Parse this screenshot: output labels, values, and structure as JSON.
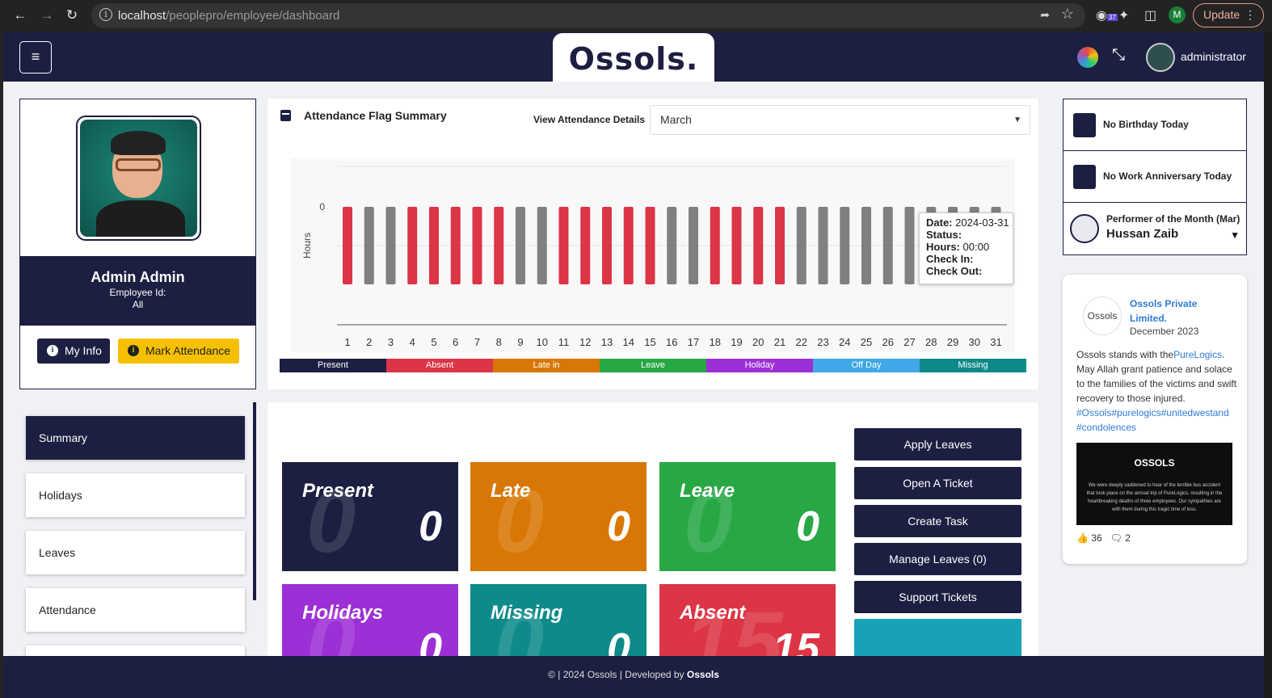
{
  "browser": {
    "url_host": "localhost",
    "url_path": "/peoplepro/employee/dashboard",
    "update_label": "Update",
    "profile_initial": "M",
    "ext_badge": "37"
  },
  "header": {
    "brand": "Ossols.",
    "user": "administrator"
  },
  "profile": {
    "name": "Admin Admin",
    "employee_id_label": "Employee Id:",
    "department": "All",
    "myinfo_label": "My Info",
    "mark_label": "Mark Attendance"
  },
  "sidebar": {
    "items": [
      {
        "label": "Summary"
      },
      {
        "label": "Holidays"
      },
      {
        "label": "Leaves"
      },
      {
        "label": "Attendance"
      }
    ]
  },
  "attendance": {
    "title": "Attendance Flag Summary",
    "view_label": "View Attendance Details",
    "month": "March",
    "y_label": "Hours",
    "y_tick": "0"
  },
  "chart_data": {
    "type": "bar",
    "title": "Attendance Flag Summary",
    "ylabel": "Hours",
    "categories": [
      "1",
      "2",
      "3",
      "4",
      "5",
      "6",
      "7",
      "8",
      "9",
      "10",
      "11",
      "12",
      "13",
      "14",
      "15",
      "16",
      "17",
      "18",
      "19",
      "20",
      "21",
      "22",
      "23",
      "24",
      "25",
      "26",
      "27",
      "28",
      "29",
      "30",
      "31"
    ],
    "colors": [
      "#dc3545",
      "#808080",
      "#808080",
      "#dc3545",
      "#dc3545",
      "#dc3545",
      "#dc3545",
      "#dc3545",
      "#808080",
      "#808080",
      "#dc3545",
      "#dc3545",
      "#dc3545",
      "#dc3545",
      "#dc3545",
      "#808080",
      "#808080",
      "#dc3545",
      "#dc3545",
      "#dc3545",
      "#dc3545",
      "#808080",
      "#808080",
      "#808080",
      "#808080",
      "#808080",
      "#808080",
      "#808080",
      "#808080",
      "#808080",
      "#808080"
    ],
    "legend": [
      {
        "name": "Present",
        "color": "#1c1f41"
      },
      {
        "name": "Absent",
        "color": "#dc3545"
      },
      {
        "name": "Late in",
        "color": "#d97706"
      },
      {
        "name": "Leave",
        "color": "#28a745"
      },
      {
        "name": "Holiday",
        "color": "#9d2fd6"
      },
      {
        "name": "Off Day",
        "color": "#3fa8e8"
      },
      {
        "name": "Missing",
        "color": "#0e8a8a"
      }
    ]
  },
  "tooltip": {
    "date_label": "Date:",
    "date": "2024-03-31",
    "status_label": "Status:",
    "hours_label": "Hours:",
    "hours": "00:00",
    "checkin_label": "Check In:",
    "checkout_label": "Check Out:"
  },
  "stats": [
    {
      "label": "Present",
      "value": "0",
      "bg": "0",
      "color": "#1c1f41"
    },
    {
      "label": "Late",
      "value": "0",
      "bg": "0",
      "color": "#d97706"
    },
    {
      "label": "Leave",
      "value": "0",
      "bg": "0",
      "color": "#28a745"
    },
    {
      "label": "Holidays",
      "value": "0",
      "bg": "0",
      "color": "#9d2fd6"
    },
    {
      "label": "Missing",
      "value": "0",
      "bg": "0",
      "color": "#0e8a8a"
    },
    {
      "label": "Absent",
      "value": "15",
      "bg": "15",
      "color": "#dc3545"
    }
  ],
  "actions": {
    "apply": "Apply Leaves",
    "ticket": "Open A Ticket",
    "task": "Create Task",
    "manage": "Manage Leaves (0)",
    "support": "Support Tickets"
  },
  "right": {
    "birthday": "No Birthday Today",
    "anniversary": "No Work Anniversary Today",
    "performer_title": "Performer of the Month (Mar)",
    "performer_name": "Hussan Zaib"
  },
  "fb": {
    "logo_alt": "Ossols",
    "page": "Ossols Private Limited.",
    "date": "December 2023",
    "text1": "Ossols stands with the",
    "link1": "PureLogics",
    "text2": ". May Allah grant patience and solace to the families of the victims and swift recovery to those injured.",
    "tags": "#Ossols#purelogics#unitedwestand #condolences",
    "img_title": "OSSOLS",
    "img_text": "We were deeply saddened to hear of the terrible bus accident that took place on the annual trip of PureLogics, resulting in the heartbreaking deaths of three employees. Our sympathies are with them during this tragic time of loss.",
    "likes": "36",
    "comments": "2"
  },
  "footer": {
    "text": "© | 2024 Ossols | Developed by",
    "brand": "Ossols"
  }
}
